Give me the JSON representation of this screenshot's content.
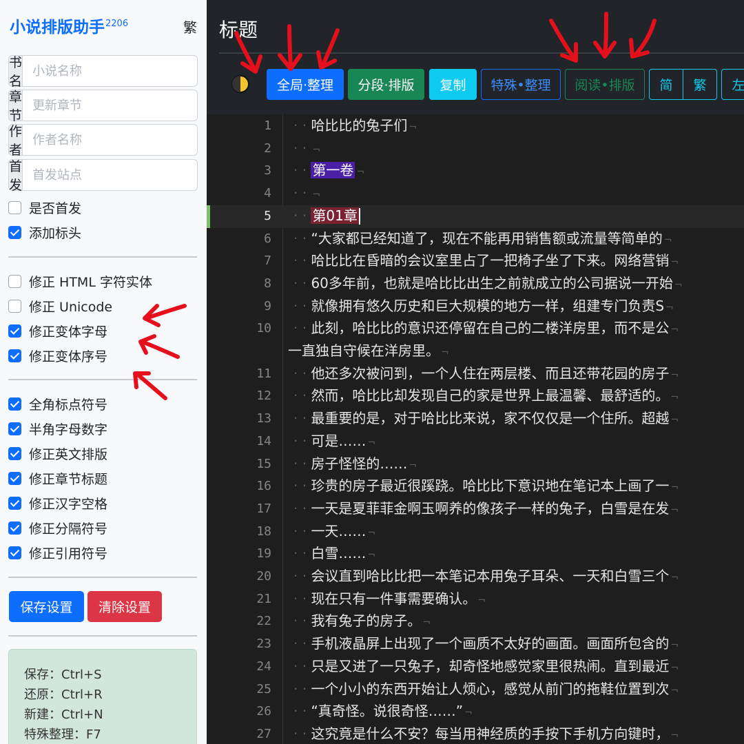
{
  "app": {
    "name": "小说排版助手",
    "version": "2206",
    "traditional_link": "繁"
  },
  "sidebar": {
    "fields": [
      {
        "label": "书名",
        "placeholder": "小说名称"
      },
      {
        "label": "章节",
        "placeholder": "更新章节"
      },
      {
        "label": "作者",
        "placeholder": "作者名称"
      },
      {
        "label": "首发",
        "placeholder": "首发站点"
      }
    ],
    "options_a": [
      {
        "label": "是否首发",
        "checked": false
      },
      {
        "label": "添加标头",
        "checked": true
      }
    ],
    "options_b": [
      {
        "label": "修正 HTML 字符实体",
        "checked": false
      },
      {
        "label": "修正 Unicode",
        "checked": false
      },
      {
        "label": "修正变体字母",
        "checked": true
      },
      {
        "label": "修正变体序号",
        "checked": true
      }
    ],
    "options_c": [
      {
        "label": "全角标点符号",
        "checked": true
      },
      {
        "label": "半角字母数字",
        "checked": true
      },
      {
        "label": "修正英文排版",
        "checked": true
      },
      {
        "label": "修正章节标题",
        "checked": true
      },
      {
        "label": "修正汉字空格",
        "checked": true
      },
      {
        "label": "修正分隔符号",
        "checked": true
      },
      {
        "label": "修正引用符号",
        "checked": true
      }
    ],
    "save_button": "保存设置",
    "clear_button": "清除设置",
    "shortcuts": [
      "保存：Ctrl+S",
      "还原：Ctrl+R",
      "新建：Ctrl+N",
      "特殊整理：F7"
    ]
  },
  "main": {
    "title": "标题",
    "toolbar": {
      "global_tidy": "全局·整理",
      "segment_layout": "分段·排版",
      "copy": "复制",
      "special_tidy": "特殊•整理",
      "read_layout": "阅读•排版",
      "simplified": "简",
      "traditional": "繁",
      "left": "左"
    },
    "colors": {
      "primary": "#0d6efd",
      "success": "#198754",
      "info": "#0dcaf0",
      "danger": "#dc3545"
    }
  },
  "editor": {
    "lines": [
      {
        "n": "1",
        "text": "哈比比的兔子们"
      },
      {
        "n": "2",
        "text": ""
      },
      {
        "n": "3",
        "text": "第一卷",
        "style": "volume"
      },
      {
        "n": "4",
        "text": ""
      },
      {
        "n": "5",
        "text": "第01章",
        "style": "chapter"
      },
      {
        "n": "6",
        "text": "“大家都已经知道了，现在不能再用销售额或流量等简单的"
      },
      {
        "n": "7",
        "text": "哈比比在昏暗的会议室里占了一把椅子坐了下来。网络营销"
      },
      {
        "n": "8",
        "text": "60多年前，也就是哈比比出生之前就成立的公司据说一开始"
      },
      {
        "n": "9",
        "text": "就像拥有悠久历史和巨大规模的地方一样，组建专门负责S"
      },
      {
        "n": "10",
        "text": "此刻，哈比比的意识还停留在自己的二楼洋房里，而不是公"
      },
      {
        "n": "",
        "text": "一直独自守候在洋房里。",
        "wrap": true
      },
      {
        "n": "11",
        "text": "他还多次被问到，一个人住在两层楼、而且还带花园的房子"
      },
      {
        "n": "12",
        "text": "然而，哈比比却发现自己的家是世界上最温馨、最舒适的。"
      },
      {
        "n": "13",
        "text": "最重要的是，对于哈比比来说，家不仅仅是一个住所。超越"
      },
      {
        "n": "14",
        "text": "可是……"
      },
      {
        "n": "15",
        "text": "房子怪怪的……"
      },
      {
        "n": "16",
        "text": "珍贵的房子最近很蹊跷。哈比比下意识地在笔记本上画了一"
      },
      {
        "n": "17",
        "text": "一天是夏菲菲金啊玉啊养的像孩子一样的兔子，白雪是在发"
      },
      {
        "n": "18",
        "text": "一天……"
      },
      {
        "n": "19",
        "text": "白雪……"
      },
      {
        "n": "20",
        "text": "会议直到哈比比把一本笔记本用兔子耳朵、一天和白雪三个"
      },
      {
        "n": "21",
        "text": "现在只有一件事需要确认。"
      },
      {
        "n": "22",
        "text": "我有兔子的房子。"
      },
      {
        "n": "23",
        "text": "手机液晶屏上出现了一个画质不太好的画面。画面所包含的"
      },
      {
        "n": "24",
        "text": "只是又进了一只兔子，却奇怪地感觉家里很热闹。直到最近"
      },
      {
        "n": "25",
        "text": "一个小小的东西开始让人烦心，感觉从前门的拖鞋位置到次"
      },
      {
        "n": "26",
        "text": "“真奇怪。说很奇怪……”"
      },
      {
        "n": "27",
        "text": "这究竟是什么不安？每当用神经质的手按下手机方向键时，"
      }
    ]
  }
}
